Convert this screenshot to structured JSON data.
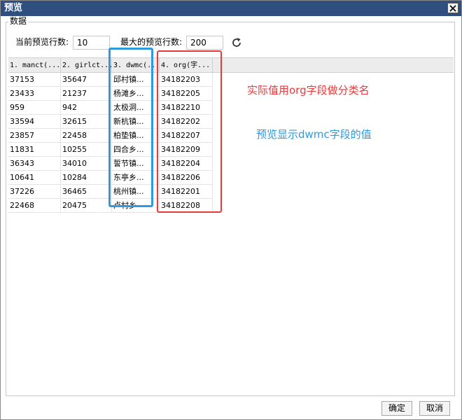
{
  "window": {
    "title": "预览"
  },
  "group": {
    "label": "数据"
  },
  "controls": {
    "current_rows_label": "当前预览行数:",
    "current_rows_value": "10",
    "max_rows_label": "最大的预览行数:",
    "max_rows_value": "200"
  },
  "grid": {
    "columns": [
      "1. manct(...",
      "2. girlct...",
      "3. dwmc(...",
      "4. org(字..."
    ],
    "rows": [
      [
        "37153",
        "35647",
        "邱村镇...",
        "34182203"
      ],
      [
        "23433",
        "21237",
        "杨滩乡...",
        "34182205"
      ],
      [
        "959",
        "942",
        "太极洞...",
        "34182210"
      ],
      [
        "33594",
        "32615",
        "新杭镇...",
        "34182202"
      ],
      [
        "23857",
        "22458",
        "柏垫镇...",
        "34182207"
      ],
      [
        "11831",
        "10255",
        "四合乡...",
        "34182209"
      ],
      [
        "36343",
        "34010",
        "誓节镇...",
        "34182204"
      ],
      [
        "10641",
        "10284",
        "东亭乡...",
        "34182206"
      ],
      [
        "37226",
        "36465",
        "桃州镇...",
        "34182201"
      ],
      [
        "22468",
        "20475",
        "卢村乡",
        "34182208"
      ]
    ]
  },
  "annotations": {
    "red_text": "实际值用org字段做分类名",
    "blue_text": "预览显示dwmc字段的值",
    "red_color": "#e53b3b",
    "blue_color": "#2f9ae0"
  },
  "footer": {
    "ok": "确定",
    "cancel": "取消"
  }
}
